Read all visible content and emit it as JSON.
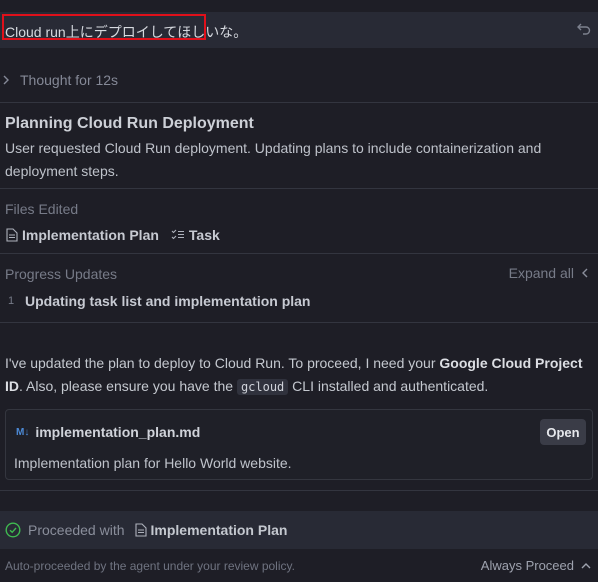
{
  "user_message": {
    "text": "Cloud run上にデプロイしてほしいな。"
  },
  "thought": {
    "label": "Thought for 12s"
  },
  "plan": {
    "title": "Planning Cloud Run Deployment",
    "description": "User requested Cloud Run deployment. Updating plans to include containerization and deployment steps."
  },
  "files_edited": {
    "label": "Files Edited",
    "items": [
      {
        "label": "Implementation Plan",
        "icon": "file-icon"
      },
      {
        "label": "Task",
        "icon": "checklist-icon"
      }
    ]
  },
  "progress": {
    "label": "Progress Updates",
    "expand_label": "Expand all",
    "items": [
      {
        "number": "1",
        "text": "Updating task list and implementation plan"
      }
    ]
  },
  "message": {
    "part1": "I've updated the plan to deploy to Cloud Run. To proceed, I need your ",
    "bold1": "Google Cloud Project ID",
    "part2": ". Also, please ensure you have the ",
    "code": "gcloud",
    "part3": " CLI installed and authenticated."
  },
  "artifact_card": {
    "badge": "M↓",
    "filename": "implementation_plan.md",
    "description": "Implementation plan for Hello World website.",
    "open_label": "Open"
  },
  "proceeded": {
    "label": "Proceeded with",
    "link_label": "Implementation Plan"
  },
  "footer": {
    "policy_text": "Auto-proceeded by the agent under your review policy.",
    "mode_label": "Always Proceed"
  },
  "colors": {
    "highlight_border": "#e0101a",
    "success": "#3fb950",
    "md_badge": "#4c8ad6"
  }
}
